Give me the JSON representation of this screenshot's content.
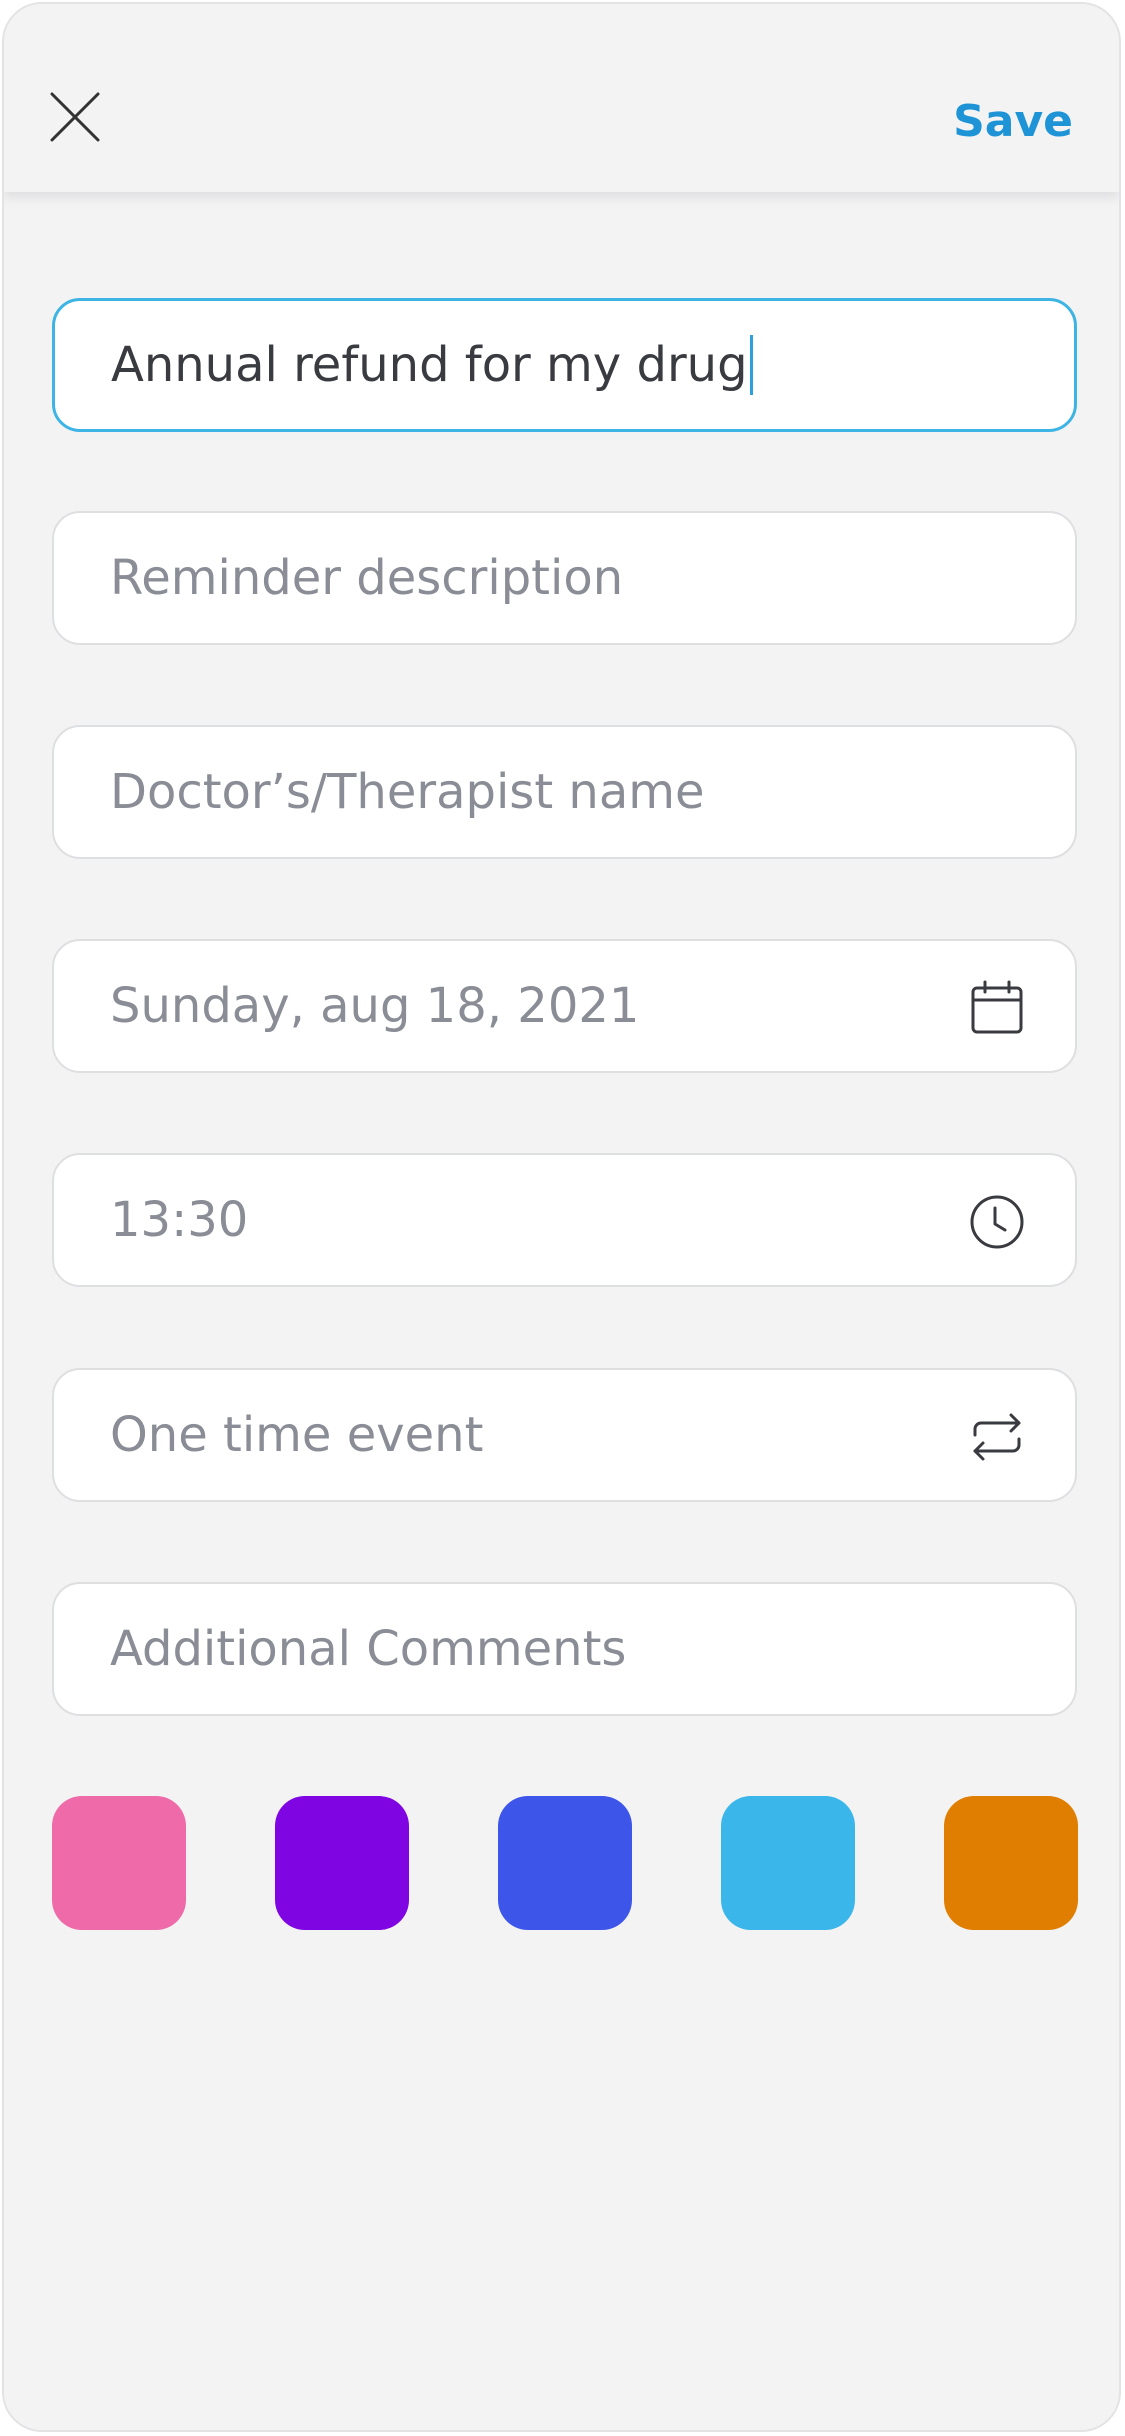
{
  "header": {
    "close_icon": "close-icon",
    "save_label": "Save"
  },
  "form": {
    "title_value": "Annual refund for my drug",
    "description_placeholder": "Reminder description",
    "doctor_placeholder": "Doctor’s/Therapist name",
    "date_value": "Sunday, aug 18, 2021",
    "date_icon": "calendar-icon",
    "time_value": "13:30",
    "time_icon": "clock-icon",
    "repeat_value": "One time event",
    "repeat_icon": "repeat-icon",
    "comments_placeholder": "Additional Comments"
  },
  "colors": {
    "accent": "#1e94d6",
    "active_border": "#3db4e3",
    "swatches": [
      "#ef6aa8",
      "#7f05e2",
      "#3d56e9",
      "#3bb6ea",
      "#e07e02"
    ]
  }
}
